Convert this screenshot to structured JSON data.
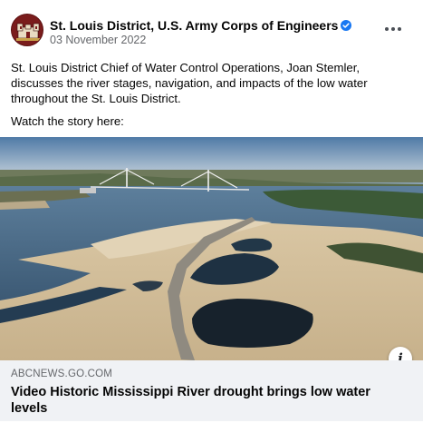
{
  "post": {
    "page_name": "St. Louis District, U.S. Army Corps of Engineers",
    "date": "03 November 2022",
    "body": "St. Louis District Chief of Water Control Operations, Joan Stemler, discusses the river stages, navigation, and impacts of the low water throughout the St. Louis District.",
    "watch_label": "Watch the story here:"
  },
  "link_card": {
    "domain": "ABCNEWS.GO.COM",
    "title": "Video Historic Mississippi River drought brings low water levels",
    "info_label": "i"
  },
  "icons": {
    "avatar": "army-corps-castle-logo",
    "verified": "verified-badge-icon",
    "more": "more-options-icon",
    "info": "info-icon"
  },
  "colors": {
    "verified": "#1877f2",
    "avatar_bg": "#7a1c1c",
    "footer_bg": "#f0f2f5",
    "secondary_text": "#65676b"
  }
}
